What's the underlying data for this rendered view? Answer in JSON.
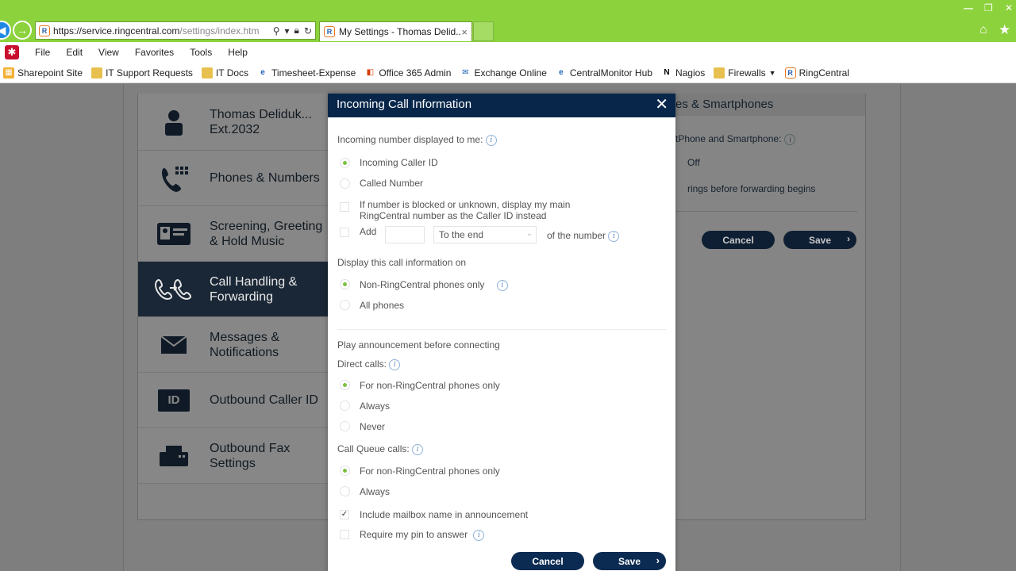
{
  "browser": {
    "url_main": "https://service.ringcentral.com",
    "url_path": "/settings/index.htm",
    "tab_title": "My Settings - Thomas Delid...",
    "tab_close": "×",
    "menu": [
      "File",
      "Edit",
      "View",
      "Favorites",
      "Tools",
      "Help"
    ],
    "favorites": [
      {
        "label": "Sharepoint Site",
        "icon": "sharepoint-icon"
      },
      {
        "label": "IT Support Requests",
        "icon": "folder-icon"
      },
      {
        "label": "IT Docs",
        "icon": "folder-icon"
      },
      {
        "label": "Timesheet-Expense",
        "icon": "ie-page-icon"
      },
      {
        "label": "Office 365 Admin",
        "icon": "office365-icon"
      },
      {
        "label": "Exchange Online",
        "icon": "exchange-icon"
      },
      {
        "label": "CentralMonitor Hub",
        "icon": "ie-page-icon"
      },
      {
        "label": "Nagios",
        "icon": "nagios-icon"
      },
      {
        "label": "Firewalls",
        "icon": "folder-icon"
      },
      {
        "label": "RingCentral",
        "icon": "ringcentral-icon"
      }
    ],
    "titlebar_color": "#8cd23c"
  },
  "sidebar": {
    "items": [
      {
        "label_1": "Thomas Deliduk...",
        "label_2": "Ext.2032",
        "icon": "user-icon"
      },
      {
        "label_1": "Phones & Numbers",
        "label_2": "",
        "icon": "phone-icon"
      },
      {
        "label_1": "Screening, Greeting",
        "label_2": "& Hold Music",
        "icon": "id-card-icon"
      },
      {
        "label_1": "Call Handling &",
        "label_2": "Forwarding",
        "icon": "call-forward-icon"
      },
      {
        "label_1": "Messages &",
        "label_2": "Notifications",
        "icon": "envelope-icon"
      },
      {
        "label_1": "Outbound Caller ID",
        "label_2": "",
        "icon": "caller-id-icon",
        "badge": "ID"
      },
      {
        "label_1": "Outbound Fax",
        "label_2": "Settings",
        "icon": "fax-icon"
      }
    ],
    "active_index": 3
  },
  "background_pane": {
    "header": "es & Smartphones",
    "line1": "tPhone and Smartphone:",
    "line2": "Off",
    "line3": "rings before forwarding begins",
    "cancel": "Cancel",
    "save": "Save"
  },
  "dialog": {
    "title": "Incoming Call Information",
    "incoming_label": "Incoming number displayed to me:",
    "opt_caller_id": "Incoming Caller ID",
    "opt_called_number": "Called Number",
    "blocked_line1": "If number is blocked or unknown, display my main",
    "blocked_line2": "RingCentral number as the Caller ID instead",
    "add_label": "Add",
    "add_value": "",
    "position_value": "To the end",
    "of_number": "of the number",
    "display_on_label": "Display this call information on",
    "opt_non_rc": "Non-RingCentral phones only",
    "opt_all_phones": "All phones",
    "announce_label": "Play announcement before connecting",
    "direct_calls_label": "Direct calls:",
    "direct_opt1": "For non-RingCentral phones only",
    "direct_opt2": "Always",
    "direct_opt3": "Never",
    "queue_label": "Call Queue calls:",
    "queue_opt1": "For non-RingCentral phones only",
    "queue_opt2": "Always",
    "include_mailbox": "Include mailbox name in announcement",
    "require_pin": "Require my pin to answer",
    "cancel": "Cancel",
    "save": "Save",
    "accent_color": "#7cc142",
    "header_color": "#07264a"
  }
}
